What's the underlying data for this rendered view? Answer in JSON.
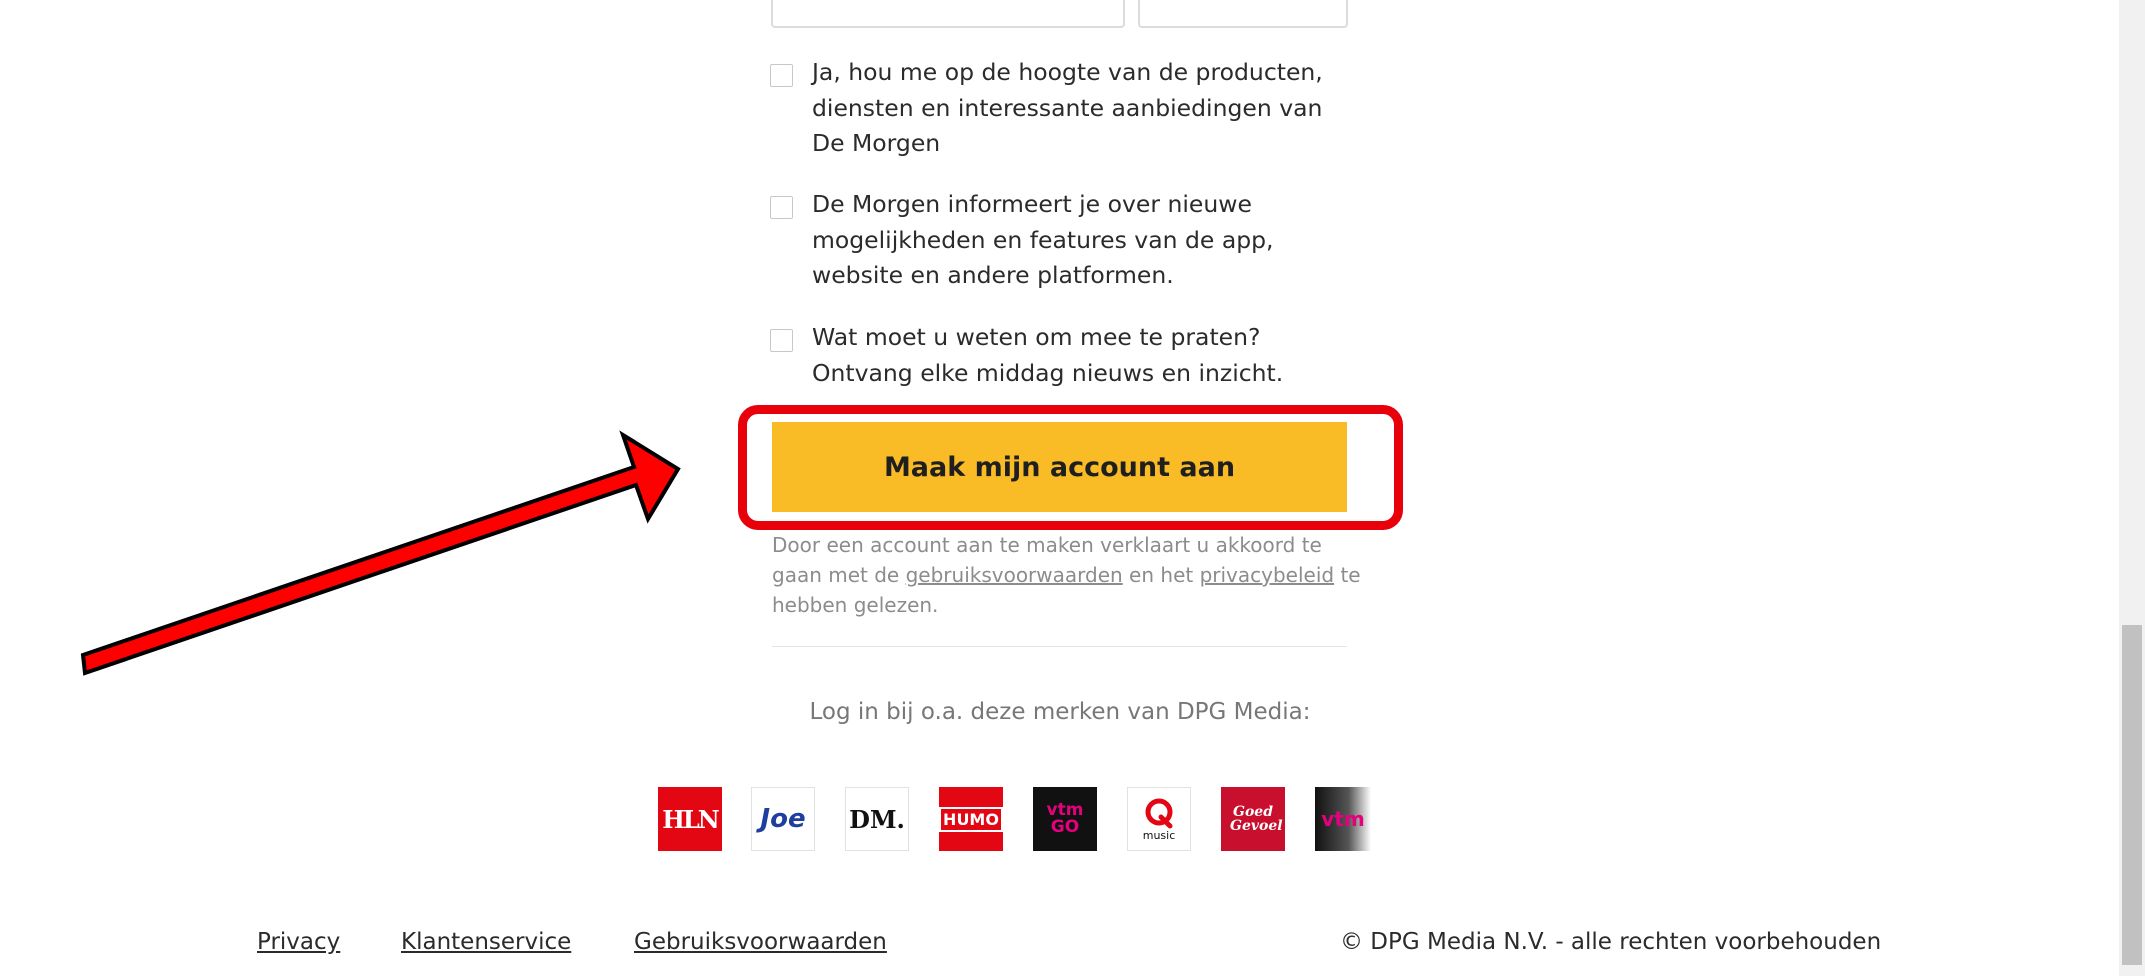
{
  "form": {
    "checkboxes": [
      {
        "label": "Ja, hou me op de hoogte van de producten, diensten en interessante aanbiedingen van De Morgen",
        "checked": false
      },
      {
        "label": "De Morgen informeert je over nieuwe mogelijkheden en features van de app, website en andere platformen.",
        "checked": false
      },
      {
        "label": "Wat moet u weten om mee te praten? Ontvang elke middag nieuws en inzicht.",
        "checked": false
      }
    ],
    "submit_label": "Maak mijn account aan",
    "legal": {
      "text_before": "Door een account aan te maken verklaart u akkoord te gaan met de ",
      "terms_link": "gebruiksvoorwaarden",
      "text_middle": " en het ",
      "privacy_link": "privacybeleid",
      "text_after": " te hebben gelezen."
    }
  },
  "brands": {
    "title": "Log in bij o.a. deze merken van DPG Media:",
    "logos": [
      {
        "name": "HLN",
        "text": "HLN",
        "bg": "#e30613",
        "fg": "#ffffff"
      },
      {
        "name": "Joe",
        "text": "Joe",
        "bg": "#ffffff",
        "fg": "#1e3fa0"
      },
      {
        "name": "DM",
        "text": "DM.",
        "bg": "#ffffff",
        "fg": "#111111"
      },
      {
        "name": "Humo",
        "text": "HUMO",
        "bg": "#e30613",
        "fg": "#ffffff"
      },
      {
        "name": "VTM GO",
        "text": "vtm GO",
        "bg": "#111111",
        "fg": "#e5007e"
      },
      {
        "name": "Q-music",
        "text": "music",
        "bg": "#ffffff",
        "fg": "#e30613"
      },
      {
        "name": "Goed Gevoel",
        "text": "Goed Gevoel",
        "bg": "#c8102e",
        "fg": "#ffffff"
      },
      {
        "name": "VTM",
        "text": "vtm",
        "bg": "#222222",
        "fg": "#e5007e"
      }
    ]
  },
  "footer": {
    "links": [
      "Privacy",
      "Klantenservice",
      "Gebruiksvoorwaarden"
    ],
    "copyright": "© DPG Media N.V. - alle rechten voorbehouden"
  },
  "annotation": {
    "arrow_color": "#ff0000",
    "highlight_color": "#e8000b"
  }
}
